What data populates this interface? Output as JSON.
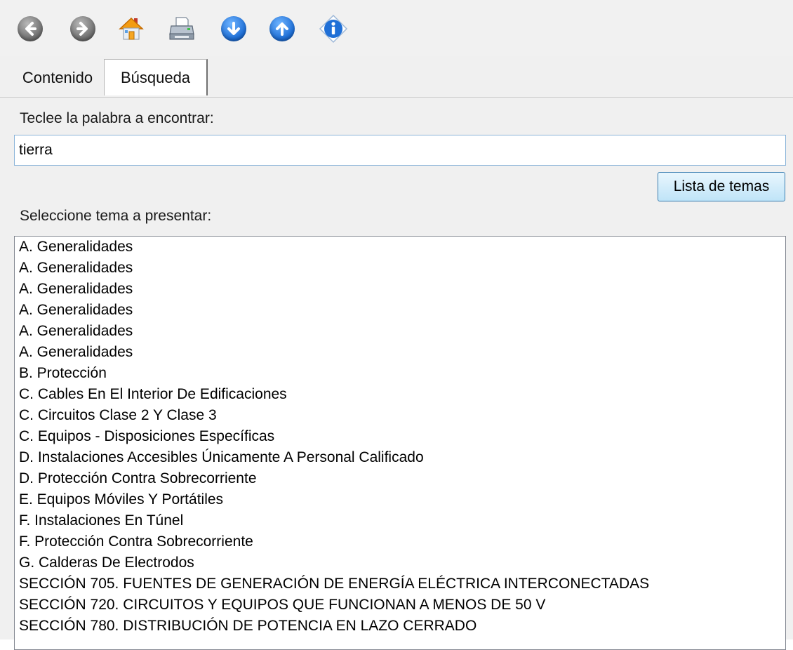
{
  "toolbar": {
    "buttons": [
      {
        "name": "back",
        "icon": "arrow-left-icon"
      },
      {
        "name": "forward",
        "icon": "arrow-right-icon"
      },
      {
        "name": "home",
        "icon": "home-icon"
      },
      {
        "name": "print",
        "icon": "printer-icon"
      },
      {
        "name": "next-topic",
        "icon": "arrow-down-icon"
      },
      {
        "name": "previous-topic",
        "icon": "arrow-up-icon"
      },
      {
        "name": "about",
        "icon": "info-icon"
      }
    ]
  },
  "tabs": [
    {
      "label": "Contenido"
    },
    {
      "label": "Búsqueda"
    }
  ],
  "search": {
    "prompt": "Teclee la palabra a encontrar:",
    "value": "tierra",
    "button_label": "Lista de temas",
    "list_prompt": "Seleccione tema a presentar:"
  },
  "results": [
    "A. Generalidades",
    "A. Generalidades",
    "A. Generalidades",
    "A. Generalidades",
    "A. Generalidades",
    "A. Generalidades",
    "B. Protección",
    "C. Cables En El Interior De Edificaciones",
    "C. Circuitos Clase 2 Y Clase 3",
    "C. Equipos - Disposiciones Específicas",
    "D. Instalaciones Accesibles Únicamente A Personal Calificado",
    "D. Protección Contra Sobrecorriente",
    "E. Equipos Móviles Y Portátiles",
    "F. Instalaciones En Túnel",
    "F. Protección Contra Sobrecorriente",
    "G. Calderas De Electrodos",
    "SECCIÓN 705. FUENTES DE GENERACIÓN DE ENERGÍA ELÉCTRICA INTERCONECTADAS",
    "SECCIÓN 720. CIRCUITOS Y EQUIPOS QUE FUNCIONAN A MENOS DE 50 V",
    "SECCIÓN 780. DISTRIBUCIÓN DE POTENCIA EN LAZO CERRADO"
  ]
}
